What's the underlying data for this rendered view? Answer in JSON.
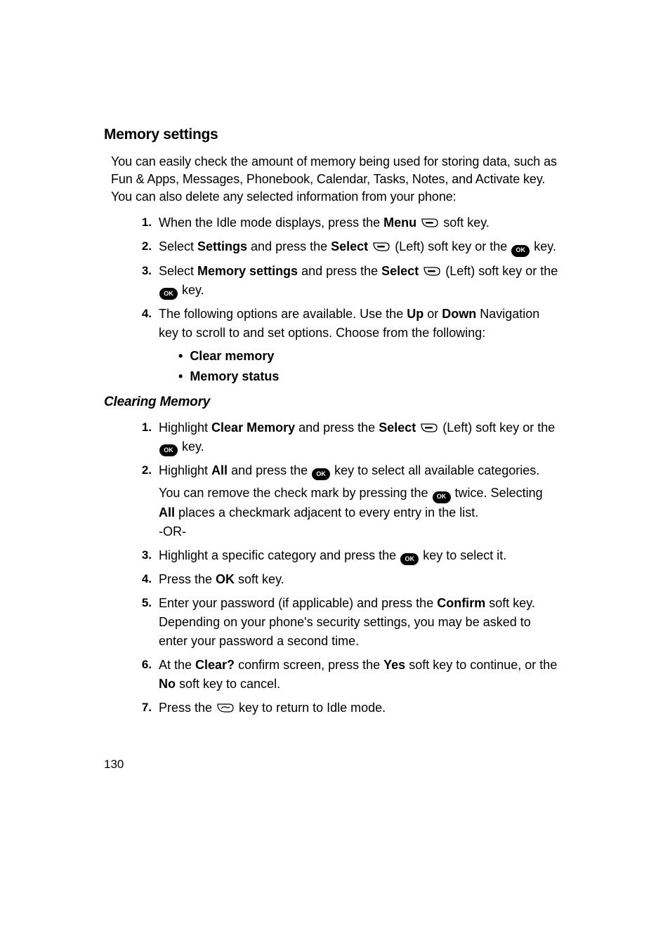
{
  "h1": "Memory settings",
  "intro": "You can easily check the amount of memory being used for storing data, such as Fun & Apps, Messages, Phonebook, Calendar, Tasks, Notes, and Activate key. You can also delete any selected information from your phone:",
  "steps1": {
    "n1": "1.",
    "s1a": "When the Idle mode displays, press the ",
    "s1b": "Menu",
    "s1c": " soft key.",
    "n2": "2.",
    "s2a": "Select ",
    "s2b": "Settings",
    "s2c": " and press the ",
    "s2d": "Select",
    "s2e": " (Left) soft key or the ",
    "s2f": " key.",
    "n3": "3.",
    "s3a": "Select ",
    "s3b": "Memory settings",
    "s3c": " and press the ",
    "s3d": "Select",
    "s3e": " (Left) soft key or the ",
    "s3f": " key.",
    "n4": "4.",
    "s4a": "The following options are available. Use the ",
    "s4b": "Up",
    "s4c": " or ",
    "s4d": "Down",
    "s4e": " Navigation key to scroll to and set options. Choose from the following:",
    "b1": "Clear memory",
    "b2": "Memory status"
  },
  "h2": "Clearing Memory",
  "steps2": {
    "n1": "1.",
    "c1a": "Highlight ",
    "c1b": "Clear Memory",
    "c1c": " and press the ",
    "c1d": "Select",
    "c1e": " (Left) soft key or the ",
    "c1f": " key.",
    "n2": "2.",
    "c2a": "Highlight ",
    "c2b": "All",
    "c2c": " and press the ",
    "c2d": " key to select all available categories.",
    "c2e": "You can remove the check mark by pressing the ",
    "c2f": " twice. Selecting ",
    "c2g": "All",
    "c2h": " places a checkmark adjacent to every entry in the list.",
    "c2i": "-OR-",
    "n3": "3.",
    "c3a": "Highlight a specific category and press the ",
    "c3b": " key to select it.",
    "n4": "4.",
    "c4a": "Press the ",
    "c4b": "OK",
    "c4c": " soft key.",
    "n5": "5.",
    "c5a": "Enter your password (if applicable) and press the ",
    "c5b": "Confirm",
    "c5c": " soft key. Depending on your phone's security settings, you may be asked to enter your password a second time.",
    "n6": "6.",
    "c6a": "At the ",
    "c6b": "Clear?",
    "c6c": " confirm screen, press the ",
    "c6d": "Yes",
    "c6e": " soft key to continue, or the ",
    "c6f": "No",
    "c6g": " soft key to cancel.",
    "n7": "7.",
    "c7a": "Press the ",
    "c7b": " key to return to Idle mode."
  },
  "pageNum": "130",
  "okLabel": "OK"
}
